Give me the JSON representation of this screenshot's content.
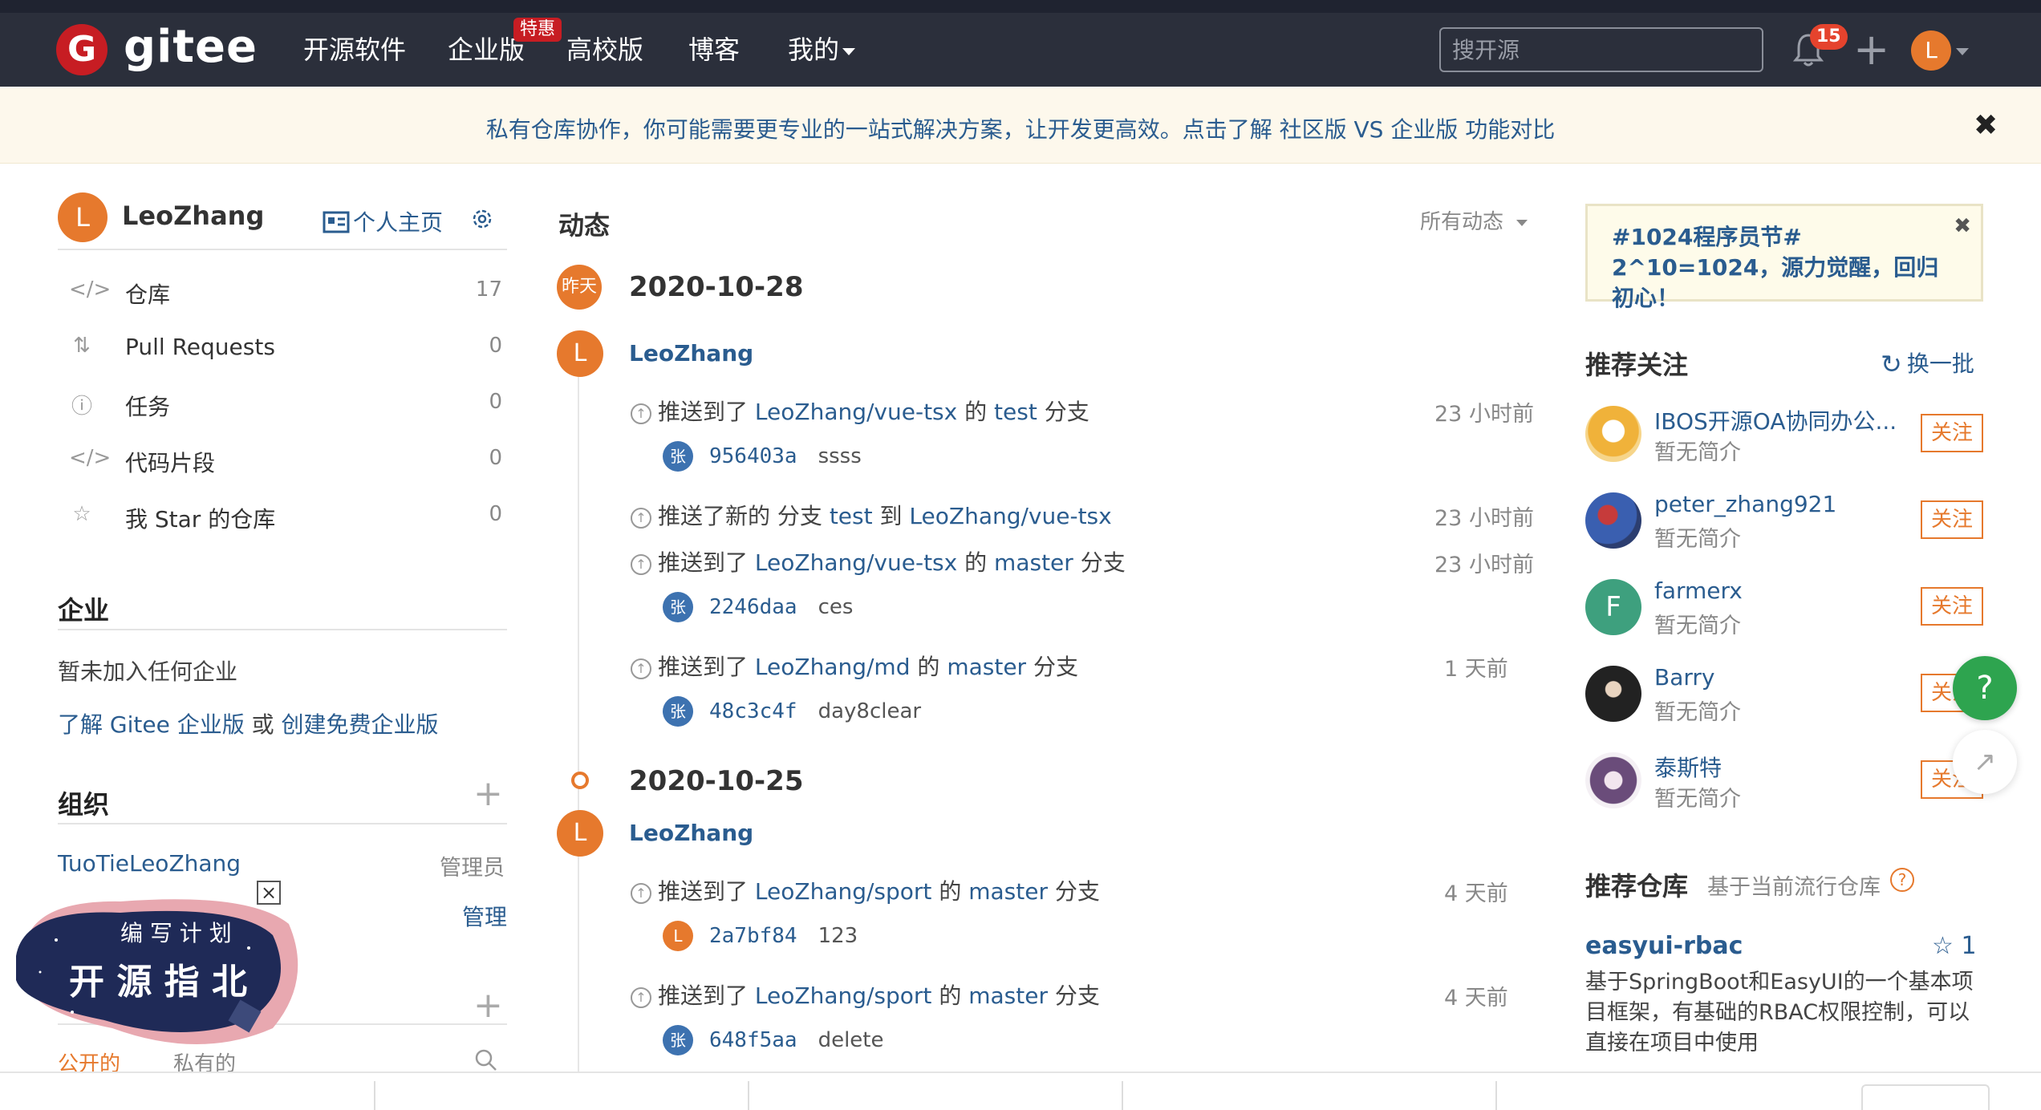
{
  "header": {
    "logo_letter": "G",
    "logo_text": "gitee",
    "nav": [
      {
        "label": "开源软件"
      },
      {
        "label": "企业版"
      },
      {
        "label": "高校版"
      },
      {
        "label": "博客"
      },
      {
        "label": "我的"
      }
    ],
    "enterprise_badge": "特惠",
    "search_placeholder": "搜开源",
    "notification_count": "15",
    "avatar_letter": "L"
  },
  "notice": {
    "text": "私有仓库协作，你可能需要更专业的一站式解决方案，让开发更高效。点击了解 社区版 VS 企业版 功能对比",
    "close": "✖"
  },
  "profile": {
    "avatar_letter": "L",
    "username": "LeoZhang",
    "homepage_label": "个人主页",
    "menu": [
      {
        "label": "仓库",
        "count": "17",
        "icon": "repo-icon"
      },
      {
        "label": "Pull Requests",
        "count": "0",
        "icon": "pull-request-icon"
      },
      {
        "label": "任务",
        "count": "0",
        "icon": "issue-icon"
      },
      {
        "label": "代码片段",
        "count": "0",
        "icon": "code-snippet-icon"
      },
      {
        "label": "我 Star 的仓库",
        "count": "0",
        "icon": "star-icon"
      }
    ]
  },
  "enterprise": {
    "title": "企业",
    "empty_text": "暂未加入任何企业",
    "link_learn": "了解 Gitee 企业版",
    "link_or": "或",
    "link_create": "创建免费企业版"
  },
  "org": {
    "title": "组织",
    "org_name": "TuoTieLeoZhang",
    "org_role": "管理员",
    "manage_label": "管理"
  },
  "repo_tabs": {
    "public": "公开的",
    "private": "私有的"
  },
  "promo": {
    "line1": "编 写 计 划",
    "line2": "开 源 指 北"
  },
  "feed": {
    "title": "动态",
    "filter": "所有动态",
    "groups": [
      {
        "date_badge": "昨天",
        "date": "2020-10-28",
        "user": "LeoZhang",
        "avatar": "L",
        "activities": [
          {
            "prefix": "推送到了",
            "repo": "LeoZhang/vue-tsx",
            "mid": "的",
            "branch": "test",
            "suffix": "分支",
            "time": "23 小时前",
            "commits": [
              {
                "avatar": "张",
                "sha": "956403a",
                "msg": "ssss"
              }
            ]
          },
          {
            "prefix": "推送了新的 分支",
            "repo": "test",
            "mid": "到",
            "branch": "LeoZhang/vue-tsx",
            "suffix": "",
            "time": "23 小时前",
            "commits": []
          },
          {
            "prefix": "推送到了",
            "repo": "LeoZhang/vue-tsx",
            "mid": "的",
            "branch": "master",
            "suffix": "分支",
            "time": "23 小时前",
            "commits": [
              {
                "avatar": "张",
                "sha": "2246daa",
                "msg": "ces"
              }
            ]
          },
          {
            "prefix": "推送到了",
            "repo": "LeoZhang/md",
            "mid": "的",
            "branch": "master",
            "suffix": "分支",
            "time": "1 天前",
            "commits": [
              {
                "avatar": "张",
                "sha": "48c3c4f",
                "msg": "day8clear"
              }
            ]
          }
        ]
      },
      {
        "date_badge": "",
        "date": "2020-10-25",
        "user": "LeoZhang",
        "avatar": "L",
        "activities": [
          {
            "prefix": "推送到了",
            "repo": "LeoZhang/sport",
            "mid": "的",
            "branch": "master",
            "suffix": "分支",
            "time": "4 天前",
            "commits": [
              {
                "avatar": "L",
                "sha": "2a7bf84",
                "msg": "123"
              }
            ]
          },
          {
            "prefix": "推送到了",
            "repo": "LeoZhang/sport",
            "mid": "的",
            "branch": "master",
            "suffix": "分支",
            "time": "4 天前",
            "commits": [
              {
                "avatar": "张",
                "sha": "648f5aa",
                "msg": "delete"
              }
            ]
          }
        ]
      }
    ]
  },
  "right": {
    "promo_card": "#1024程序员节# 2^10=1024，源力觉醒，回归初心！",
    "recommend_title": "推荐关注",
    "refresh_label": "换一批",
    "follow_label": "关注",
    "recommend": [
      {
        "name": "IBOS开源OA协同办公...",
        "desc": "暂无简介",
        "color": "#f0b23a"
      },
      {
        "name": "peter_zhang921",
        "desc": "暂无简介",
        "color": "#3a5fb0"
      },
      {
        "name": "farmerx",
        "desc": "暂无简介",
        "color": "#3ea07e",
        "letter": "F"
      },
      {
        "name": "Barry",
        "desc": "暂无简介",
        "color": "#444444"
      },
      {
        "name": "泰斯特",
        "desc": "暂无简介",
        "color": "#6a4c7a"
      }
    ],
    "repo_title": "推荐仓库",
    "repo_subtitle": "基于当前流行仓库",
    "repo": {
      "name": "easyui-rbac",
      "stars": "1",
      "desc": "基于SpringBoot和EasyUI的一个基本项目框架，有基础的RBAC权限控制，可以直接在项目中使用"
    },
    "help_label": "?"
  }
}
